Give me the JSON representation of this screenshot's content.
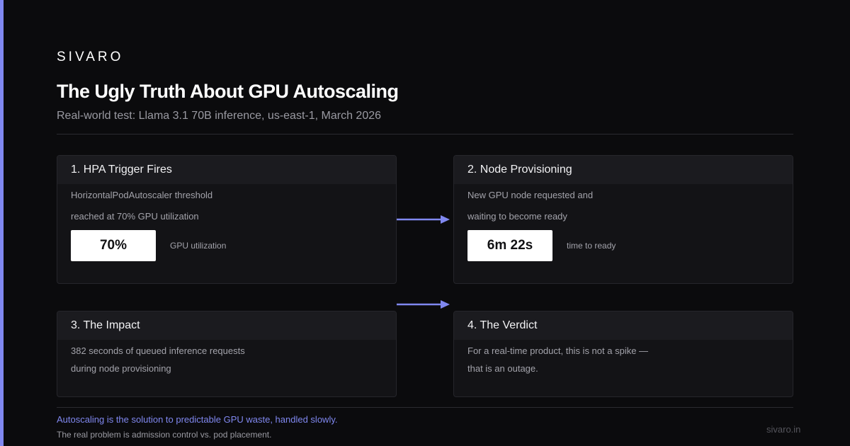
{
  "brand": "SIVARO",
  "title": "The Ugly Truth About GPU Autoscaling",
  "subtitle": "Real-world test: Llama 3.1 70B inference, us-east-1, March 2026",
  "cards": [
    {
      "heading": "1. HPA Trigger Fires",
      "lines": [
        "HorizontalPodAutoscaler threshold",
        "reached at 70% GPU utilization"
      ],
      "metric_value": "70%",
      "metric_label": "GPU utilization"
    },
    {
      "heading": "2. Node Provisioning",
      "lines": [
        "New GPU node requested and",
        "waiting to become ready"
      ],
      "metric_value": "6m 22s",
      "metric_label": "time to ready"
    },
    {
      "heading": "3. The Impact",
      "lines": [
        "382 seconds of queued inference requests",
        "during node provisioning"
      ]
    },
    {
      "heading": "4. The Verdict",
      "lines": [
        "For a real-time product, this is not a spike —",
        "that is an outage."
      ]
    }
  ],
  "footer": {
    "main": "Autoscaling is the solution to predictable GPU waste, handled slowly.",
    "sub": "The real problem is admission control vs. pod placement.",
    "site": "sivaro.in"
  },
  "colors": {
    "accent": "#8088f0",
    "background": "#0b0b0d",
    "card": "#131316",
    "card_header": "#1b1b1f"
  },
  "icons": [
    "arrow-right-icon",
    "arrow-right-icon"
  ]
}
